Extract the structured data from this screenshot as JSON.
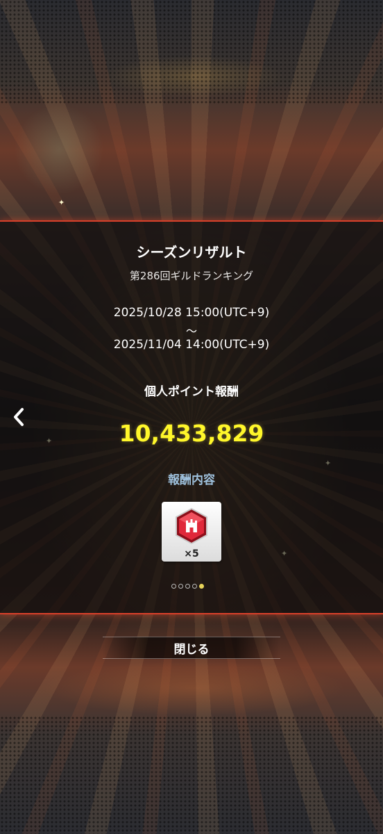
{
  "season_result": {
    "title": "シーズンリザルト",
    "subtitle": "第286回ギルドランキング",
    "period_start": "2025/10/28 15:00(UTC+9)",
    "period_separator": "〜",
    "period_end": "2025/11/04 14:00(UTC+9)",
    "points_label": "個人ポイント報酬",
    "points_value": "10,433,829",
    "reward_label": "報酬内容",
    "reward": {
      "icon": "red-hexagon-castle-gem-icon",
      "quantity": "×5"
    },
    "pager": {
      "total": 5,
      "current": 5
    }
  },
  "close_button_label": "閉じる",
  "colors": {
    "accent_red": "#d9402a",
    "points_yellow": "#fff72a",
    "reward_label_blue": "#9fc2de"
  }
}
